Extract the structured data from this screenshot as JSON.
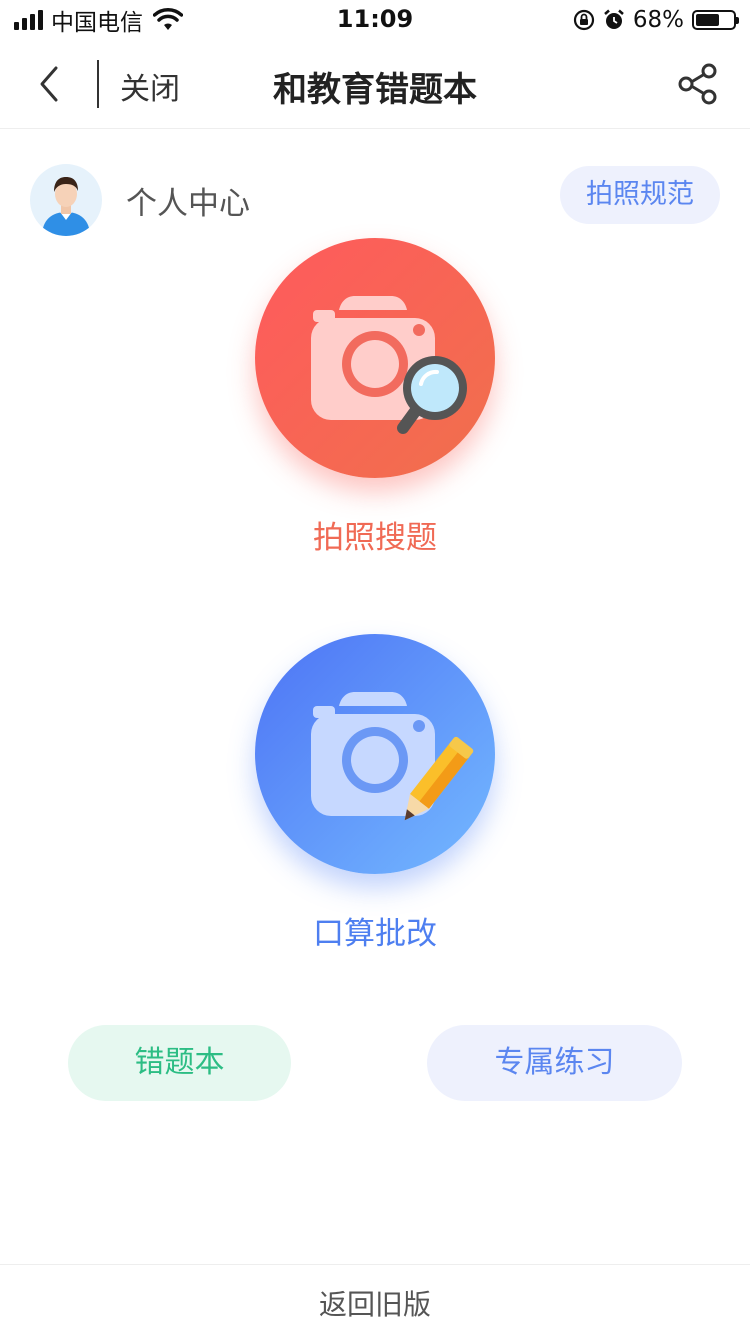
{
  "status_bar": {
    "carrier": "中国电信",
    "time": "11:09",
    "battery_percent": "68%",
    "battery_level": 0.68,
    "icons": [
      "signal-icon",
      "wifi-icon",
      "rotation-lock-icon",
      "alarm-icon",
      "battery-icon"
    ]
  },
  "nav": {
    "back_icon": "chevron-left-icon",
    "close_label": "关闭",
    "title": "和教育错题本",
    "share_icon": "share-icon"
  },
  "profile": {
    "label": "个人中心",
    "avatar_icon": "user-avatar-icon"
  },
  "photo_guide_label": "拍照规范",
  "main": {
    "photo_search_label": "拍照搜题",
    "mental_math_label": "口算批改"
  },
  "buttons": {
    "wrong_book_label": "错题本",
    "practice_label": "专属练习"
  },
  "footer": {
    "return_old_label": "返回旧版"
  },
  "colors": {
    "red_gradient_start": "#ff5a5d",
    "red_gradient_end": "#f0704c",
    "blue_gradient_start": "#4d74f5",
    "blue_gradient_end": "#74b9ff",
    "green_text": "#2cbd84",
    "blue_text": "#5b86f0",
    "red_text": "#f06a55"
  }
}
